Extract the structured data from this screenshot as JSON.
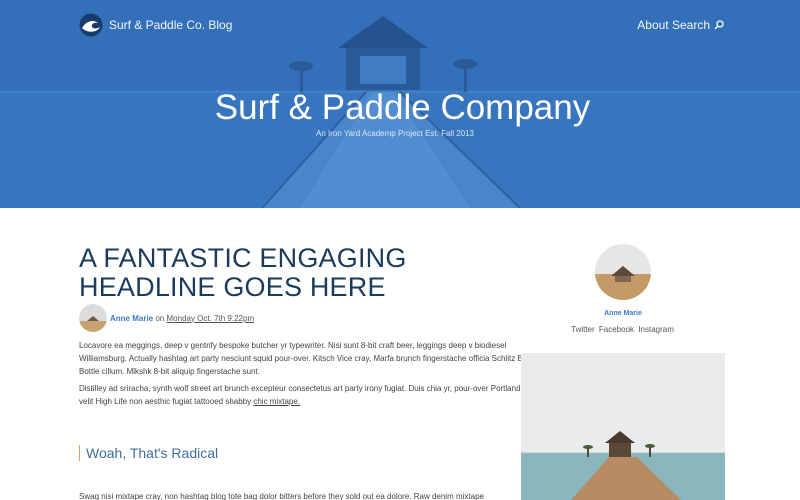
{
  "nav": {
    "brand": "Surf & Paddle Co. Blog",
    "about_search": "About Search"
  },
  "hero": {
    "title": "Surf & Paddle Company",
    "subtitle": "An Iron Yard Academp Project Est. Fall 2013"
  },
  "article": {
    "headline": "A Fantastic Engaging Headline Goes Here",
    "author": "Anne Marie",
    "on": "on",
    "date": "Monday Oct. 7th 9:22pm",
    "paragraph1": "Locavore ea meggings, deep v gentrify bespoke butcher yr typewriter. Nisi sunt 8-bit craft beer, leggings deep v biodiesel Williamsburg. Actually hashtag art party nesciunt squid pour-over. Kitsch Vice cray, Marfa brunch fingerstache officia Schlitz Blue Bottle cillum. Mlkshk 8-bit aliquip fingerstache sunt.",
    "paragraph2": "Distilley ad sriracha, synth wolf street art brunch excepteur consectetus art party irony fugiat. Duis chia yr, pour-over Portland velit High Life non aesthic fugiat tattooed shabby",
    "paragraph2_link": "chic mixtape.",
    "subheading": "Woah, That's Radical",
    "paragraph3": "Swag nisi mixtape cray, non hashtag blog tote bag dolor bitters before they sold out ea dolore. Raw denim mixtape"
  },
  "sidebar": {
    "author": "Anne Marie",
    "social": [
      "Twitter",
      "Facebook",
      "Instagram"
    ]
  },
  "colors": {
    "hero_blue": "#3672bd",
    "headline": "#1b3a5c",
    "link": "#3a7bc8",
    "subhead": "#3e6d9e"
  }
}
